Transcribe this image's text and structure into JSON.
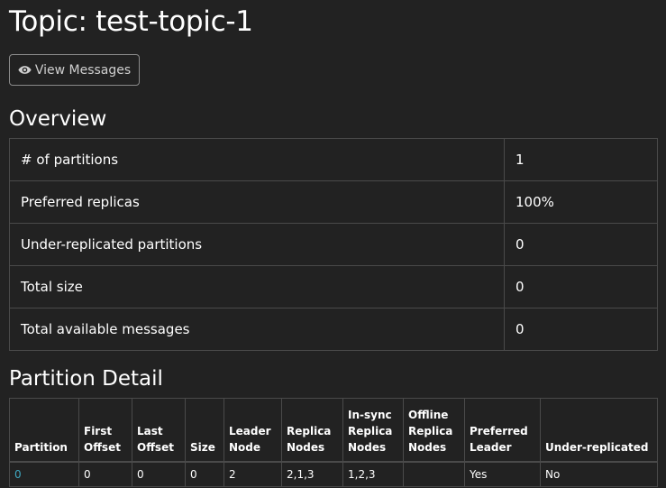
{
  "header": {
    "title": "Topic: test-topic-1"
  },
  "actions": {
    "view_messages_label": "View Messages",
    "view_messages_icon": "eye-icon"
  },
  "overview": {
    "title": "Overview",
    "rows": [
      {
        "label": "# of partitions",
        "value": "1"
      },
      {
        "label": "Preferred replicas",
        "value": "100%"
      },
      {
        "label": "Under-replicated partitions",
        "value": "0"
      },
      {
        "label": "Total size",
        "value": "0"
      },
      {
        "label": "Total available messages",
        "value": "0"
      }
    ]
  },
  "partition_detail": {
    "title": "Partition Detail",
    "columns": {
      "partition": "Partition",
      "first_offset": [
        "First",
        "Offset"
      ],
      "last_offset": [
        "Last",
        "Offset"
      ],
      "size": "Size",
      "leader_node": [
        "Leader",
        "Node"
      ],
      "replica_nodes": [
        "Replica",
        "Nodes"
      ],
      "insync_replica_nodes": [
        "In-sync",
        "Replica",
        "Nodes"
      ],
      "offline_replica_nodes": [
        "Offline",
        "Replica",
        "Nodes"
      ],
      "preferred_leader": [
        "Preferred",
        "Leader"
      ],
      "under_replicated": "Under-replicated"
    },
    "rows": [
      {
        "partition": "0",
        "first_offset": "0",
        "last_offset": "0",
        "size": "0",
        "leader_node": "2",
        "replica_nodes": "2,1,3",
        "insync_replica_nodes": "1,2,3",
        "offline_replica_nodes": "",
        "preferred_leader": "Yes",
        "under_replicated": "No"
      }
    ]
  },
  "colors": {
    "background": "#222222",
    "text": "#ffffff",
    "border": "#4a4a4a",
    "link": "#3fa7c0"
  }
}
